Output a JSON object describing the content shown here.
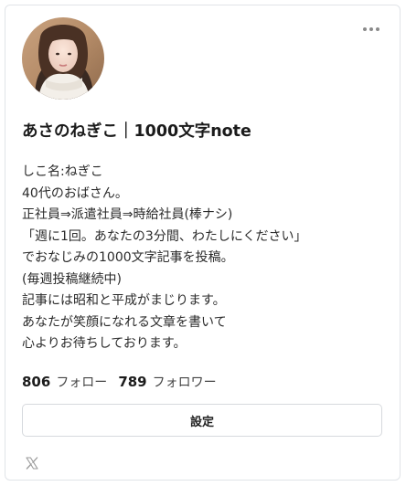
{
  "profile": {
    "name": "あさのねぎこ｜1000文字note",
    "bio_lines": [
      "しこ名:ねぎこ",
      "40代のおばさん。",
      "正社員⇒派遣社員⇒時給社員(棒ナシ)",
      "「週に1回。あなたの3分間、わたしにください」",
      "でおなじみの1000文字記事を投稿。",
      "(毎週投稿継続中)",
      "記事には昭和と平成がまじります。",
      "あなたが笑顔になれる文章を書いて",
      "心よりお待ちしております。"
    ],
    "following_count": "806",
    "following_label": "フォロー",
    "followers_count": "789",
    "followers_label": "フォロワー",
    "settings_label": "設定"
  },
  "icons": {
    "more": "more-horizontal-icon",
    "social": "x-logo-icon"
  },
  "colors": {
    "border": "#e1e4e8",
    "text": "#222222",
    "muted": "#8a8a8a"
  }
}
